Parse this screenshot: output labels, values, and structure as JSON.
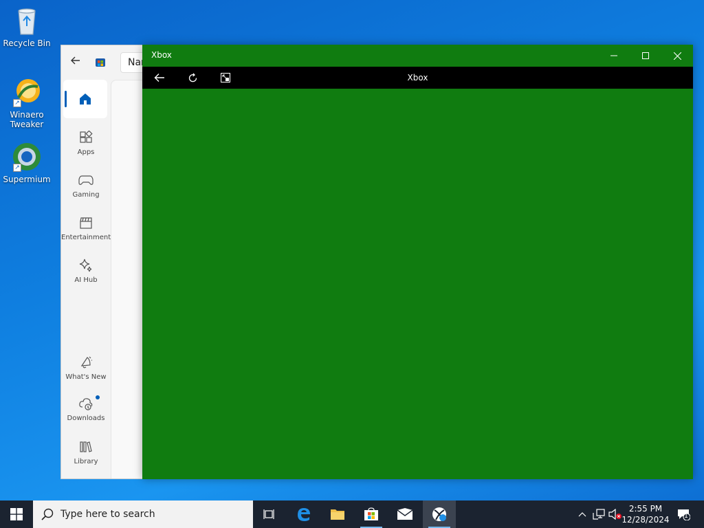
{
  "desktop": {
    "icons": [
      {
        "label": "Recycle Bin"
      },
      {
        "label": "Winaero Tweaker"
      },
      {
        "label": "Supermium"
      }
    ]
  },
  "store": {
    "search_text": "Nar",
    "nav": {
      "home": "Home",
      "apps": "Apps",
      "gaming": "Gaming",
      "entertainment": "Entertainment",
      "ai_hub": "AI Hub",
      "whats_new": "What's New",
      "downloads": "Downloads",
      "library": "Library"
    },
    "accent": "#005fb8"
  },
  "xbox_window": {
    "title": "Xbox",
    "toolbar_title": "Xbox",
    "background": "#107c10"
  },
  "taskbar": {
    "search_placeholder": "Type here to search",
    "time": "2:55 PM",
    "date": "12/28/2024",
    "notification_count": "1"
  }
}
